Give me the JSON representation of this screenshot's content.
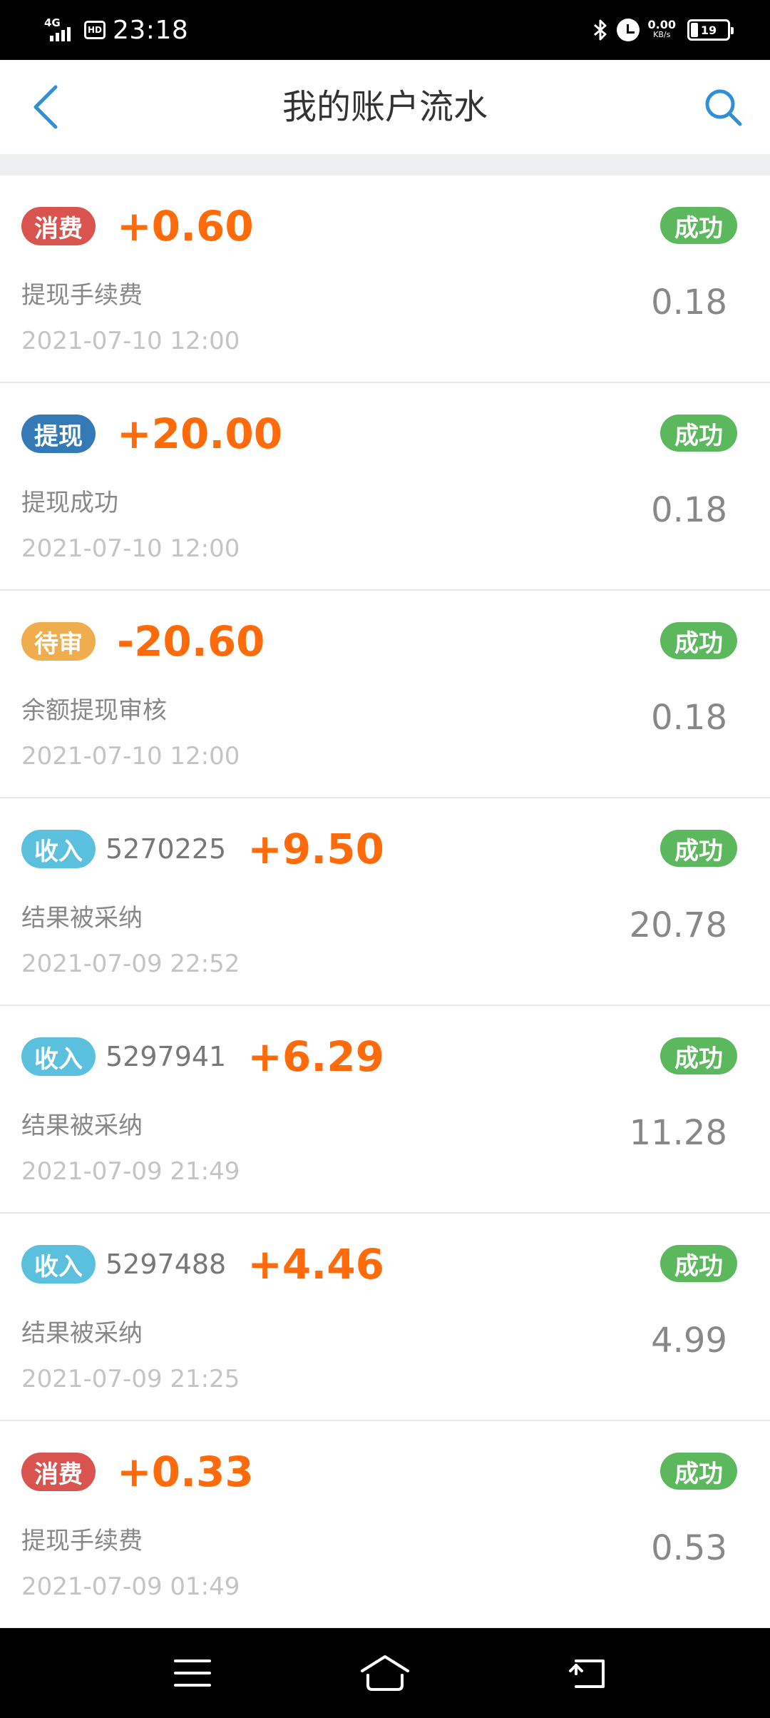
{
  "status_bar": {
    "network": "4G",
    "hd": "HD",
    "time": "23:18",
    "speed_value": "0.00",
    "speed_unit": "KB/s",
    "battery_level": 19,
    "battery_label": "19"
  },
  "header": {
    "title": "我的账户流水",
    "accent_color": "#2f8fd8"
  },
  "records": [
    {
      "tag": "消费",
      "tag_color": "#d9534f",
      "order_id": "",
      "amount": "+0.60",
      "status": "成功",
      "desc": "提现手续费",
      "date": "2021-07-10 12:00",
      "balance": "0.18"
    },
    {
      "tag": "提现",
      "tag_color": "#337ab7",
      "order_id": "",
      "amount": "+20.00",
      "status": "成功",
      "desc": "提现成功",
      "date": "2021-07-10 12:00",
      "balance": "0.18"
    },
    {
      "tag": "待审",
      "tag_color": "#f0ad4e",
      "order_id": "",
      "amount": "-20.60",
      "status": "成功",
      "desc": "余额提现审核",
      "date": "2021-07-10 12:00",
      "balance": "0.18"
    },
    {
      "tag": "收入",
      "tag_color": "#5bc0de",
      "order_id": "5270225",
      "amount": "+9.50",
      "status": "成功",
      "desc": "结果被采纳",
      "date": "2021-07-09 22:52",
      "balance": "20.78"
    },
    {
      "tag": "收入",
      "tag_color": "#5bc0de",
      "order_id": "5297941",
      "amount": "+6.29",
      "status": "成功",
      "desc": "结果被采纳",
      "date": "2021-07-09 21:49",
      "balance": "11.28"
    },
    {
      "tag": "收入",
      "tag_color": "#5bc0de",
      "order_id": "5297488",
      "amount": "+4.46",
      "status": "成功",
      "desc": "结果被采纳",
      "date": "2021-07-09 21:25",
      "balance": "4.99"
    },
    {
      "tag": "消费",
      "tag_color": "#d9534f",
      "order_id": "",
      "amount": "+0.33",
      "status": "成功",
      "desc": "提现手续费",
      "date": "2021-07-09 01:49",
      "balance": "0.53"
    }
  ],
  "nav": {
    "menu_icon": "menu-icon",
    "home_icon": "home-icon",
    "back_icon": "back-icon"
  }
}
